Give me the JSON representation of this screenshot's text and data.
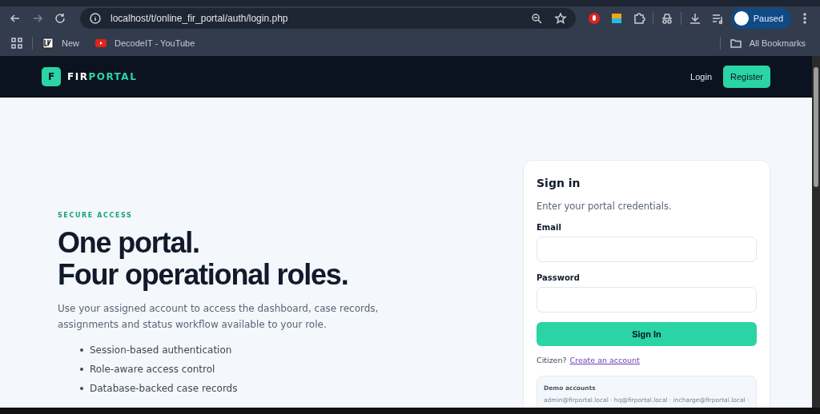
{
  "browser": {
    "address": "localhost/t/online_fir_portal/auth/login.php",
    "bookmarks": [
      {
        "label": "New",
        "kind": "site"
      },
      {
        "label": "DecodeIT - YouTube",
        "kind": "video"
      }
    ],
    "all_bookmarks": "All Bookmarks",
    "profile": "Paused"
  },
  "nav": {
    "logo_letter": "F",
    "brand": [
      {
        "text": "FIR",
        "kind": "plain"
      },
      {
        "text": "PORTAL",
        "kind": "accent"
      }
    ],
    "links": [
      {
        "label": "Login",
        "kind": "link"
      },
      {
        "label": "Register",
        "kind": "button"
      }
    ]
  },
  "hero": {
    "eyebrow": "SECURE ACCESS",
    "title_lines": [
      "One portal.",
      "Four operational roles."
    ],
    "lead": "Use your assigned account to access the dashboard, case records, assignments and status workflow available to your role.",
    "features": [
      "Session-based authentication",
      "Role-aware access control",
      "Database-backed case records"
    ]
  },
  "signin": {
    "title": "Sign in",
    "subtitle": "Enter your portal credentials.",
    "fields": [
      {
        "label": "Email"
      },
      {
        "label": "Password"
      }
    ],
    "submit": "Sign In",
    "citizen_prompt": "Citizen?",
    "register_link": "Create an account",
    "demo": {
      "title": "Demo accounts",
      "accounts": "admin@firportal.local · hq@firportal.local · incharge@firportal.local ·"
    }
  }
}
